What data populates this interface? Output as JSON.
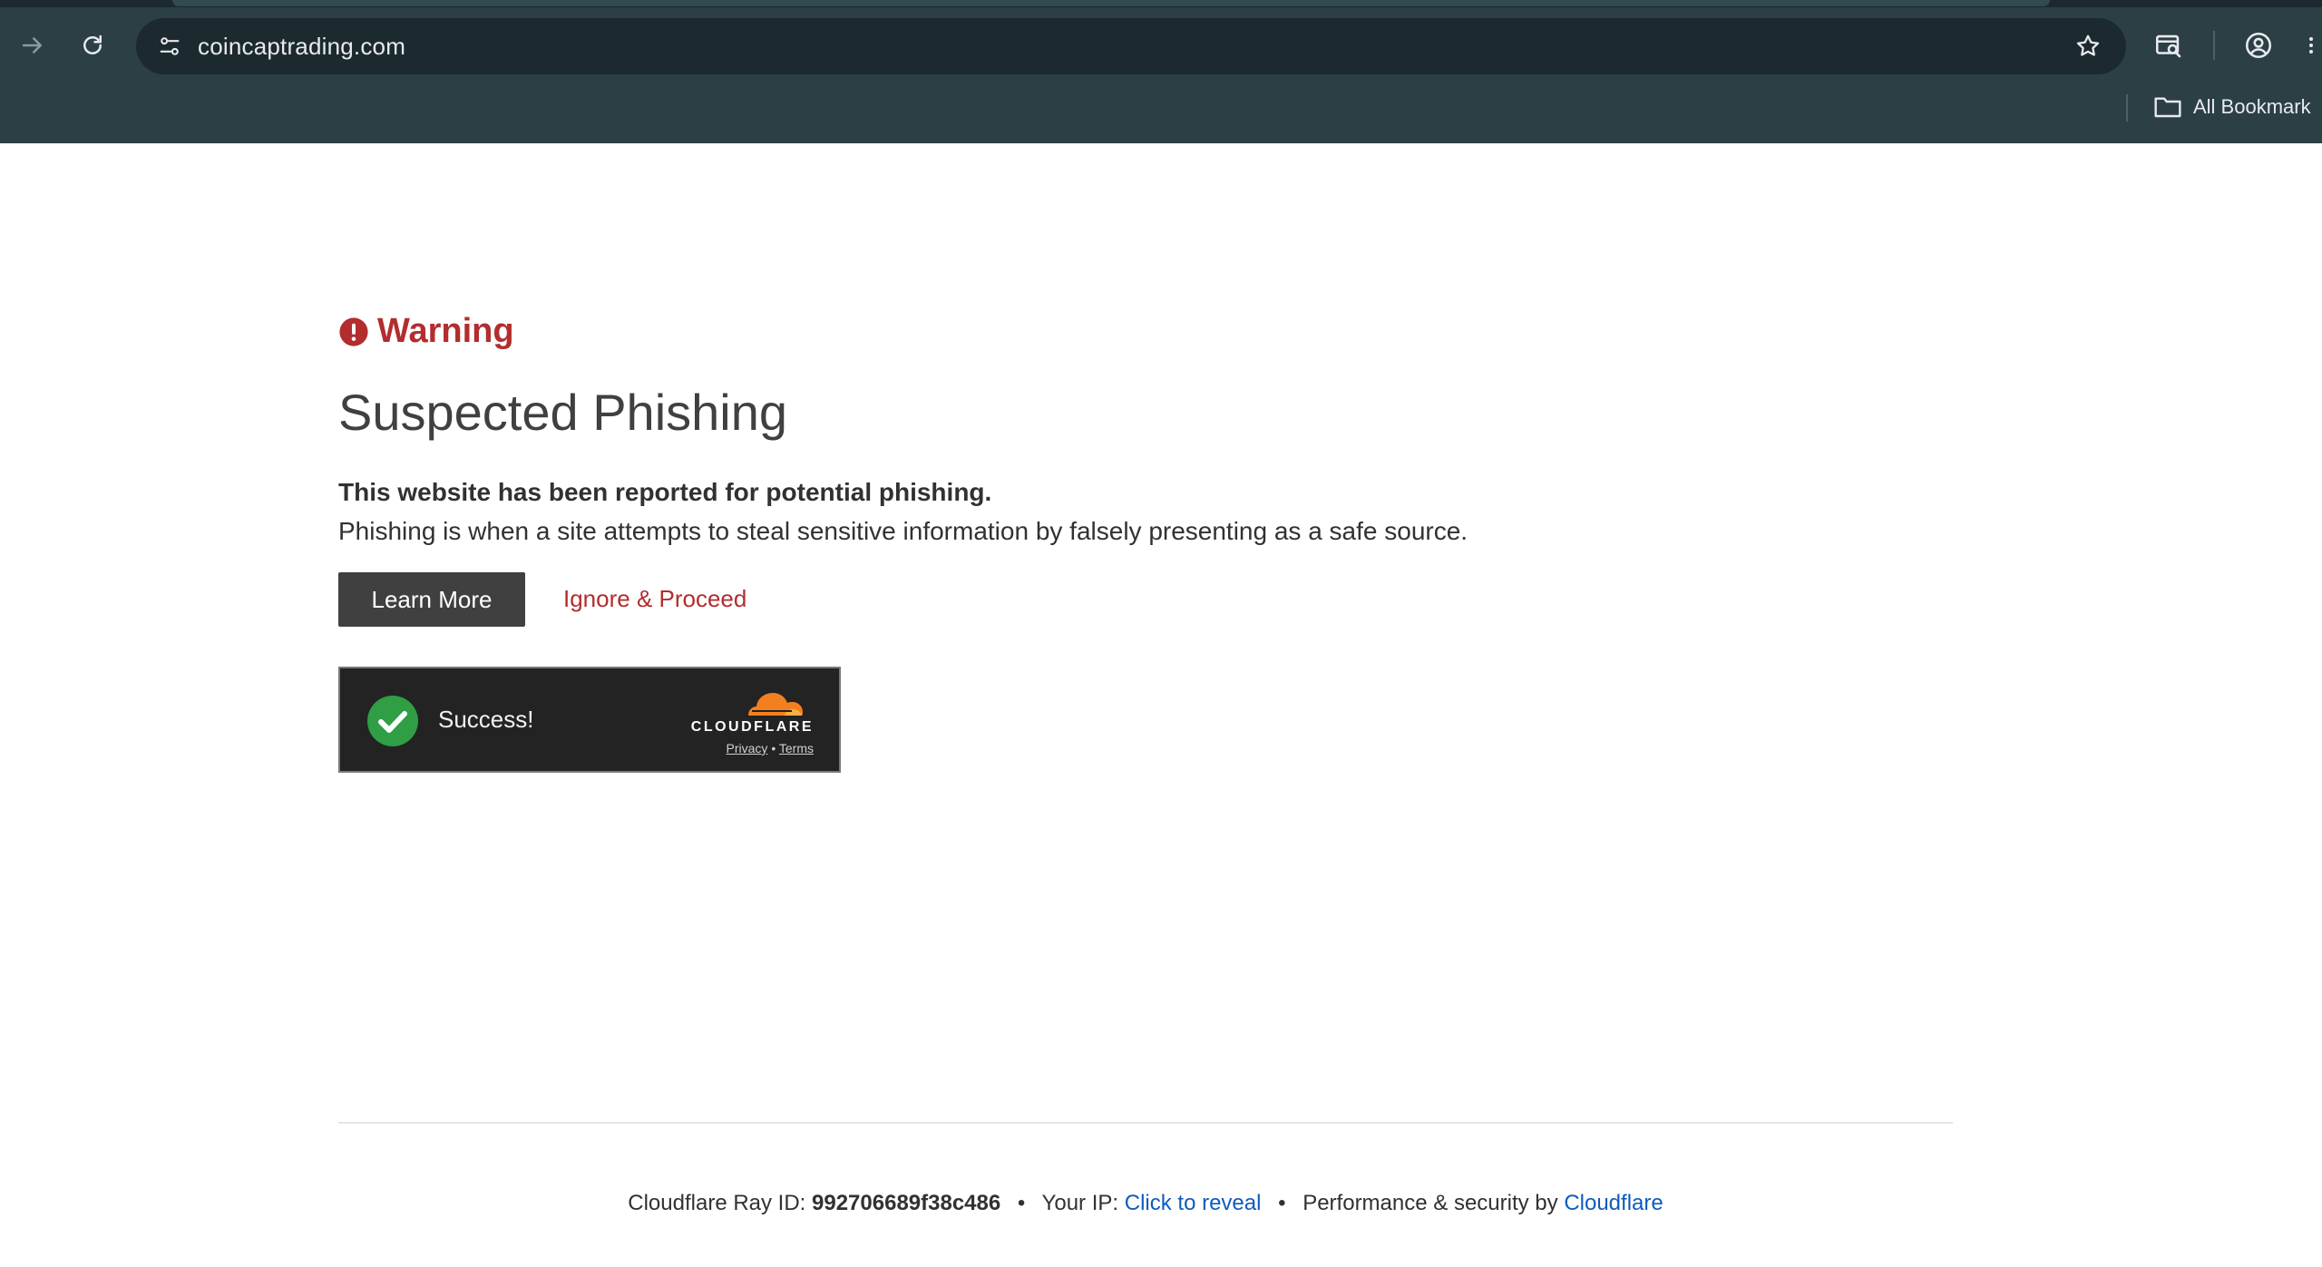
{
  "browser": {
    "url": "coincaptrading.com",
    "bookmarks_label": "All Bookmark"
  },
  "page": {
    "warning_label": "Warning",
    "heading": "Suspected Phishing",
    "lead": "This website has been reported for potential phishing.",
    "description": "Phishing is when a site attempts to steal sensitive information by falsely presenting as a safe source.",
    "learn_more_label": "Learn More",
    "ignore_label": "Ignore & Proceed",
    "accent_color": "#b32d2e"
  },
  "turnstile": {
    "status": "Success!",
    "brand": "CLOUDFLARE",
    "privacy_label": "Privacy",
    "separator": "•",
    "terms_label": "Terms"
  },
  "footer": {
    "ray_label": "Cloudflare Ray ID:",
    "ray_id": "992706689f38c486",
    "separator": "•",
    "ip_label": "Your IP:",
    "ip_link": "Click to reveal",
    "security_label": "Performance & security by",
    "security_link": "Cloudflare"
  }
}
